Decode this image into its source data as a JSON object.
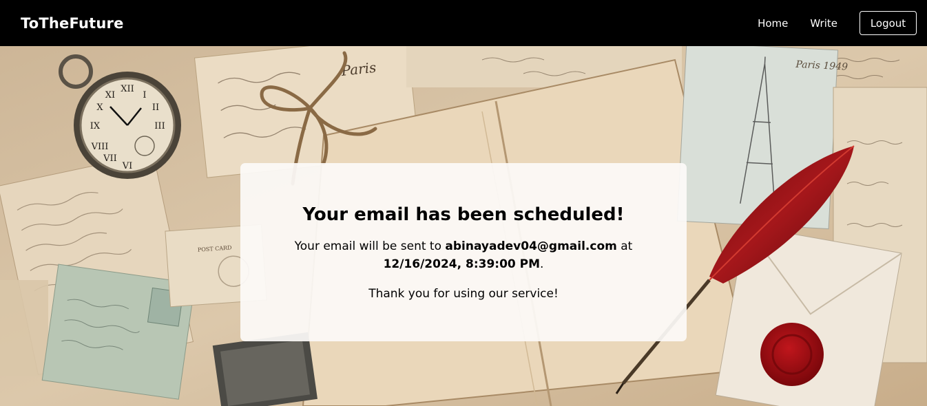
{
  "navbar": {
    "brand": "ToTheFuture",
    "links": [
      "Home",
      "Write"
    ],
    "logout_label": "Logout"
  },
  "confirmation": {
    "title": "Your email has been scheduled!",
    "msg_prefix": "Your email will be sent to",
    "email": "abinayadev04@gmail.com",
    "msg_at": "at",
    "datetime": "12/16/2024, 8:39:00 PM",
    "msg_suffix": ".",
    "thanks": "Thank you for using our service!"
  },
  "background": {
    "postcard_text": "Paris"
  },
  "colors": {
    "navbar_bg": "#000000",
    "card_bg": "#fcfaf8",
    "wax_seal": "#9b0f14",
    "quill": "#8c1212"
  }
}
